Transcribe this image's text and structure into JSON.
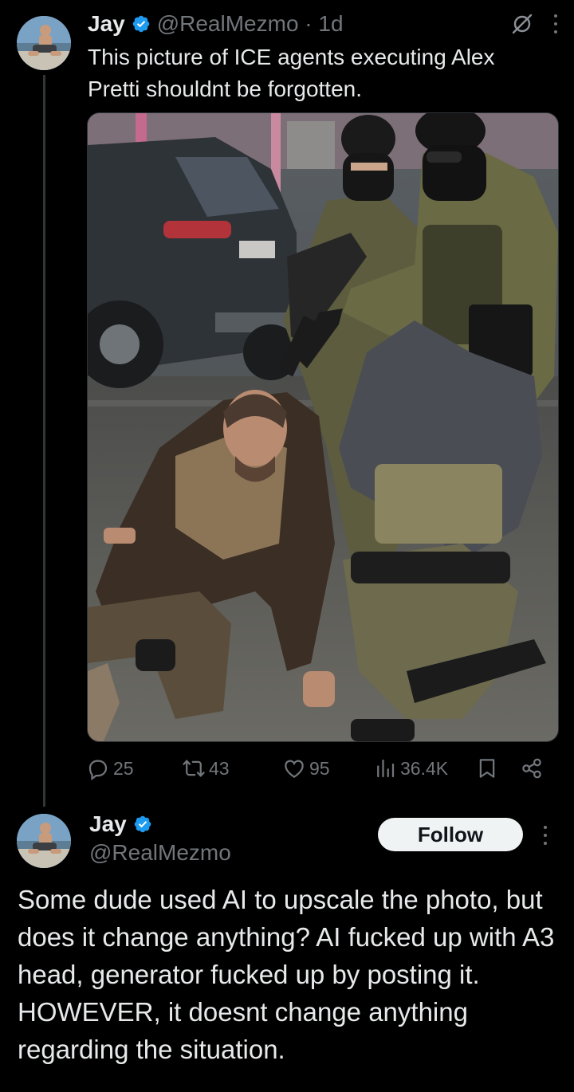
{
  "tweet": {
    "author_name": "Jay",
    "handle_time": "@RealMezmo · 1d",
    "text_line1": "This picture of ICE agents executing Alex",
    "text_line2": "Pretti shouldnt be forgotten.",
    "stats": {
      "replies": "25",
      "reposts": "43",
      "likes": "95",
      "views": "36.4K"
    }
  },
  "reply": {
    "author_name": "Jay",
    "handle": "@RealMezmo",
    "follow_label": "Follow",
    "text": "Some dude used AI to upscale the photo, but does it change anything? AI fucked up with A3 head, generator fucked up by posting it. HOWEVER, it doesnt change anything regarding the situation."
  },
  "icons": {
    "verified": "verified-badge-icon",
    "grok": "grok-icon",
    "more": "more-options-icon",
    "reply": "reply-icon",
    "repost": "repost-icon",
    "like": "like-icon",
    "views": "views-icon",
    "bookmark": "bookmark-icon",
    "share": "share-icon"
  },
  "colors": {
    "background": "#000000",
    "text": "#e7e9ea",
    "secondary": "#71767b",
    "verified": "#1d9bf0",
    "follow_bg": "#eff3f4"
  }
}
